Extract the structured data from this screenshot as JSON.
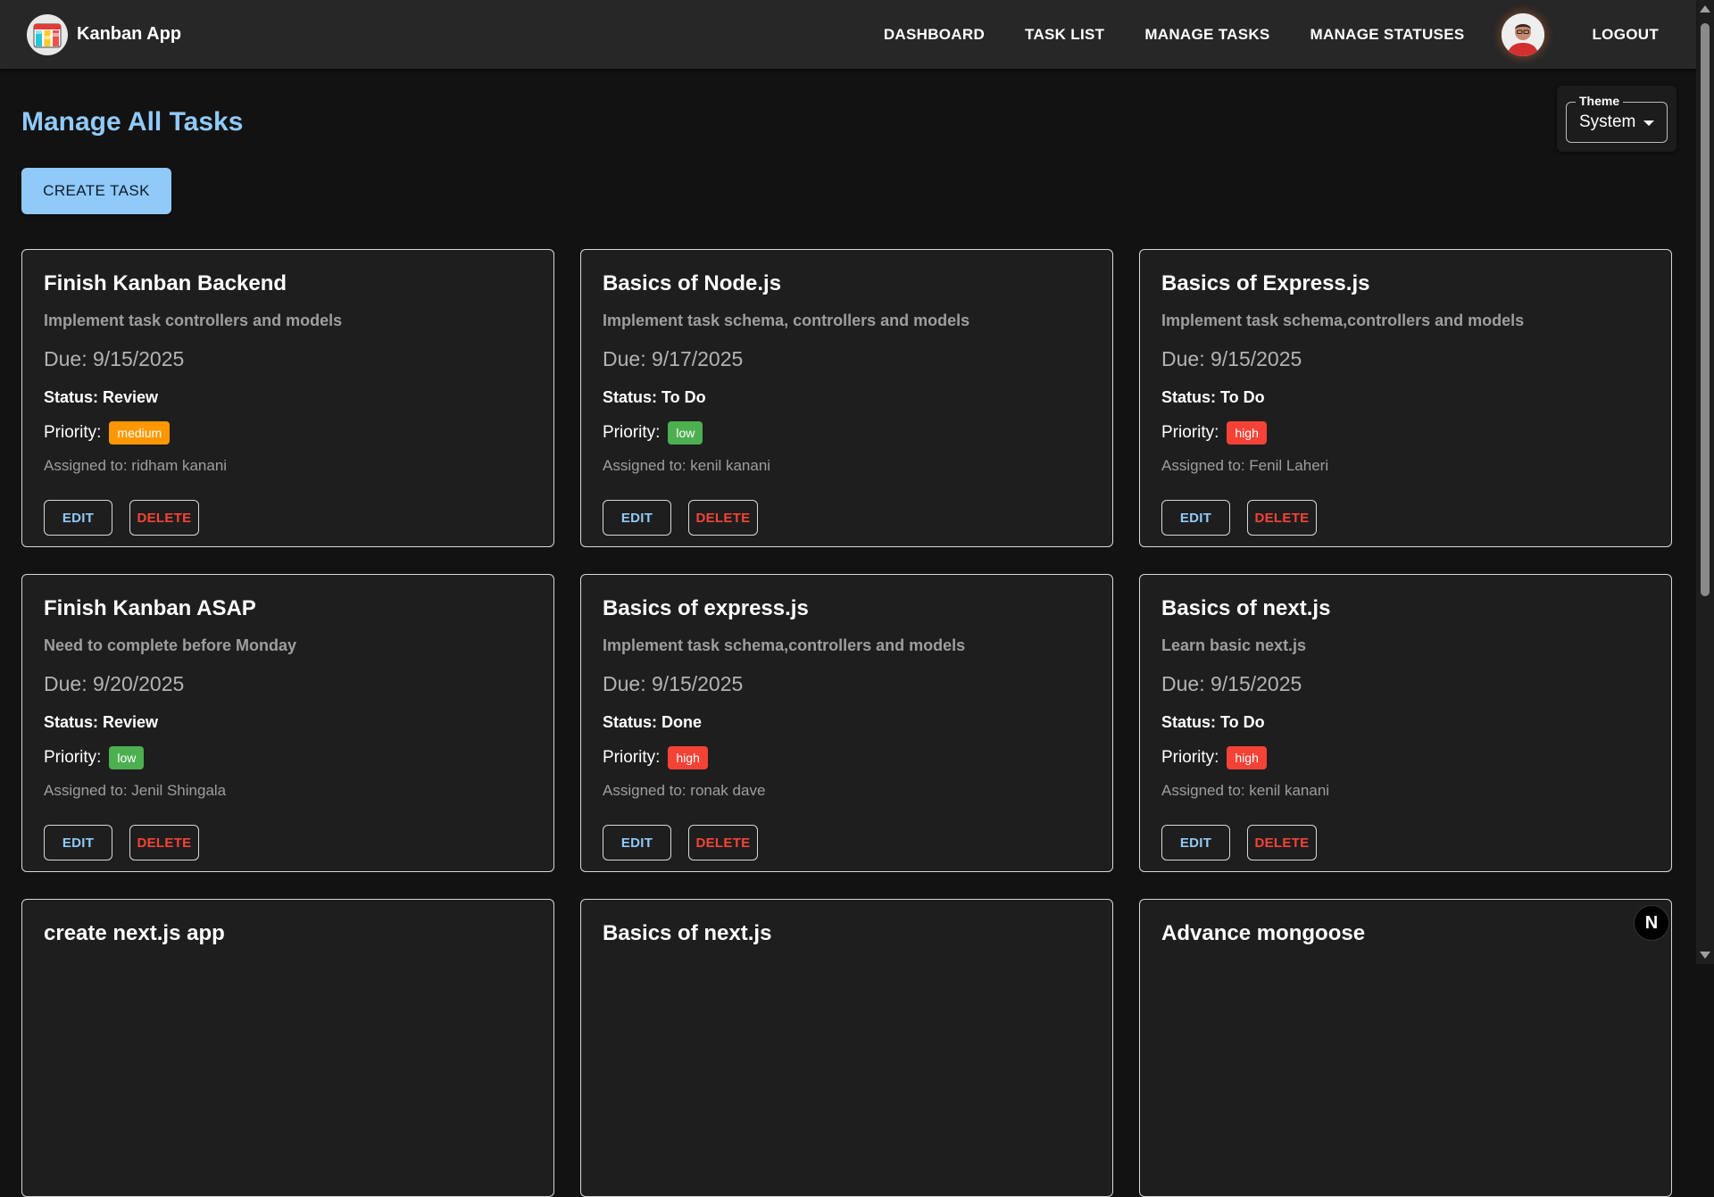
{
  "app": {
    "brand_name": "Kanban App"
  },
  "nav": [
    {
      "label": "DASHBOARD"
    },
    {
      "label": "TASK LIST"
    },
    {
      "label": "MANAGE TASKS"
    },
    {
      "label": "MANAGE STATUSES"
    },
    {
      "label": "LOGOUT"
    }
  ],
  "page": {
    "title": "Manage All Tasks",
    "create_button": "CREATE TASK"
  },
  "theme": {
    "legend": "Theme",
    "value": "System"
  },
  "card_labels": {
    "priority": "Priority:",
    "edit": "EDIT",
    "delete": "DELETE"
  },
  "colors": {
    "accent": "#90caf9",
    "priority_medium": "#ff9800",
    "priority_low": "#4caf50",
    "priority_high": "#f44336"
  },
  "tasks": [
    {
      "title": "Finish Kanban Backend",
      "description": "Implement task controllers and models",
      "due": "Due: 9/15/2025",
      "status": "Status: Review",
      "priority": "medium",
      "assignee": "Assigned to: ridham kanani"
    },
    {
      "title": "Basics of Node.js",
      "description": "Implement task schema, controllers and models",
      "due": "Due: 9/17/2025",
      "status": "Status: To Do",
      "priority": "low",
      "assignee": "Assigned to: kenil kanani"
    },
    {
      "title": "Basics of Express.js",
      "description": "Implement task schema,controllers and models",
      "due": "Due: 9/15/2025",
      "status": "Status: To Do",
      "priority": "high",
      "assignee": "Assigned to: Fenil Laheri"
    },
    {
      "title": "Finish Kanban ASAP",
      "description": "Need to complete before Monday",
      "due": "Due: 9/20/2025",
      "status": "Status: Review",
      "priority": "low",
      "assignee": "Assigned to: Jenil Shingala"
    },
    {
      "title": "Basics of express.js",
      "description": "Implement task schema,controllers and models",
      "due": "Due: 9/15/2025",
      "status": "Status: Done",
      "priority": "high",
      "assignee": "Assigned to: ronak dave"
    },
    {
      "title": "Basics of next.js",
      "description": "Learn basic next.js",
      "due": "Due: 9/15/2025",
      "status": "Status: To Do",
      "priority": "high",
      "assignee": "Assigned to: kenil kanani"
    },
    {
      "title": "create next.js app"
    },
    {
      "title": "Basics of next.js"
    },
    {
      "title": "Advance mongoose"
    }
  ],
  "fab": {
    "label": "N"
  }
}
